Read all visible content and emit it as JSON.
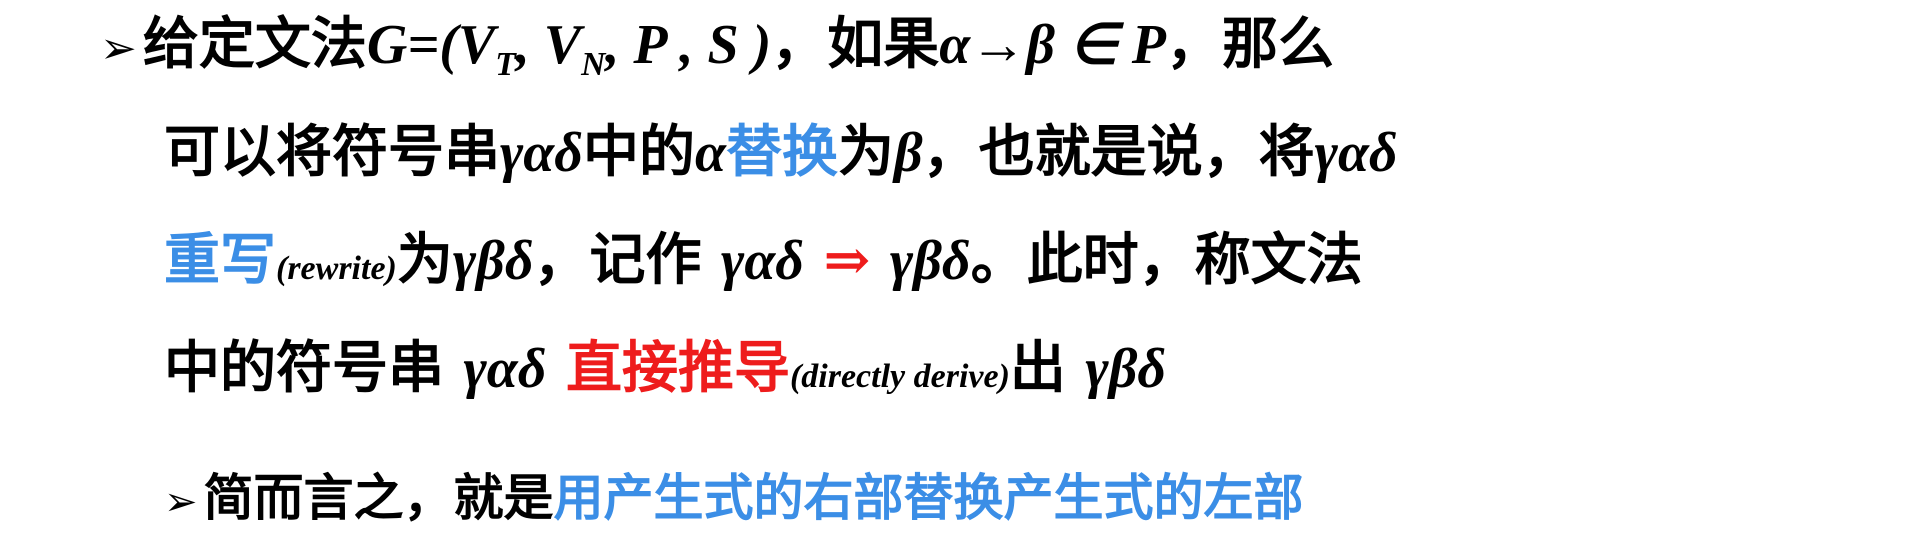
{
  "line1": {
    "bullet": "➢",
    "t1": "给定文法",
    "grammar_open": "G=(V",
    "sub_t": "T",
    "comma_v": ", V",
    "sub_n": "N",
    "grammar_rest": ", P , S )",
    "t2": "，如果",
    "rule": "α→β ∈ P",
    "t3": "，那么"
  },
  "line2": {
    "t1": "可以将符号串",
    "m1": "γαδ",
    "t2": "中的",
    "m2": "α",
    "replace_blue": "替换",
    "t3": "为",
    "m3": "β",
    "t4": "，也就是说，将",
    "m4": "γαδ"
  },
  "line3": {
    "rewrite_blue": "重写",
    "rewrite_en": "(rewrite)",
    "t1": "为",
    "m1": "γβδ",
    "t2": "，记作 ",
    "m2": "γαδ",
    "arrow_red": " ⇒ ",
    "m3": "γβδ",
    "t3": "。此时，称文法"
  },
  "line4": {
    "t1": "中的符号串 ",
    "m1": "γαδ",
    "derive_red": " 直接推导",
    "derive_en": "(directly derive)",
    "t2": "出 ",
    "m2": "γβδ"
  },
  "line5": {
    "bullet": "➢",
    "t1": "简而言之，就是",
    "summary_blue": "用产生式的右部替换产生式的左部"
  },
  "colors": {
    "text": "#000000",
    "blue": "#3b8ee6",
    "red": "#ee1c1c",
    "background": "#ffffff"
  }
}
